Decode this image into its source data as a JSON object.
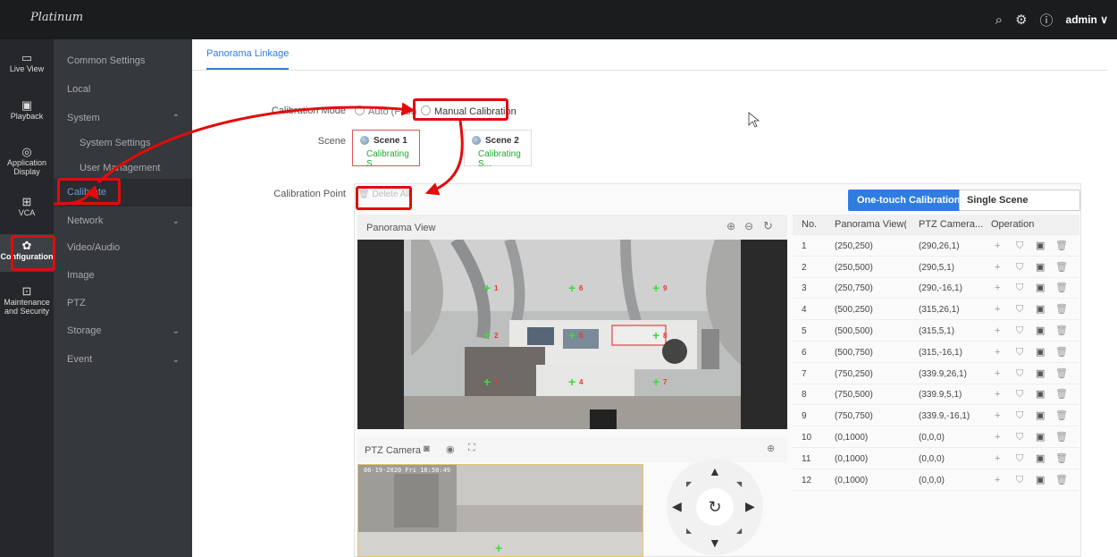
{
  "app": {
    "logo": "Platinum",
    "user": "admin ∨"
  },
  "leftnav": [
    {
      "label": "Live View",
      "icon": "▭"
    },
    {
      "label": "Playback",
      "icon": "▣"
    },
    {
      "label": "Application Display",
      "icon": "◎"
    },
    {
      "label": "VCA",
      "icon": "⊞"
    },
    {
      "label": "Configuration",
      "icon": "✿"
    },
    {
      "label": "Maintenance and Security",
      "icon": "⊡"
    }
  ],
  "subnav": {
    "common": "Common Settings",
    "local": "Local",
    "system": "System",
    "system_settings": "System Settings",
    "user_management": "User Management",
    "calibrate": "Calibrate",
    "network": "Network",
    "video_audio": "Video/Audio",
    "image": "Image",
    "ptz": "PTZ",
    "storage": "Storage",
    "event": "Event"
  },
  "tab": "Panorama Linkage",
  "form": {
    "mode_label": "Calibration Mode",
    "mode_auto": "Auto (Fast)",
    "mode_manual": "Manual Calibration",
    "scene_label": "Scene",
    "cp_label": "Calibration Point",
    "delete_all": "Delete All",
    "one_touch": "One-touch Calibration",
    "single_scene": "Single Scene Calibration"
  },
  "scenes": [
    {
      "title": "Scene 1",
      "status": "Calibrating S..."
    },
    {
      "title": "Scene 2",
      "status": "Calibrating S..."
    }
  ],
  "panorama": {
    "title": "Panorama View",
    "icons": [
      "zoom-in-icon",
      "zoom-out-icon",
      "refresh-icon"
    ]
  },
  "ptz": {
    "title": "PTZ Camera",
    "osd": "06-19-2020 Fri 16:50:49"
  },
  "table": {
    "headers": [
      "No.",
      "Panorama View(...",
      "PTZ Camera...",
      "Operation"
    ],
    "rows": [
      [
        "1",
        "(250,250)",
        "(290,26,1)"
      ],
      [
        "2",
        "(250,500)",
        "(290,5,1)"
      ],
      [
        "3",
        "(250,750)",
        "(290,-16,1)"
      ],
      [
        "4",
        "(500,250)",
        "(315,26,1)"
      ],
      [
        "5",
        "(500,500)",
        "(315,5,1)"
      ],
      [
        "6",
        "(500,750)",
        "(315,-16,1)"
      ],
      [
        "7",
        "(750,250)",
        "(339.9,26,1)"
      ],
      [
        "8",
        "(750,500)",
        "(339.9,5,1)"
      ],
      [
        "9",
        "(750,750)",
        "(339.9,-16,1)"
      ],
      [
        "10",
        "(0,1000)",
        "(0,0,0)"
      ],
      [
        "11",
        "(0,1000)",
        "(0,0,0)"
      ],
      [
        "12",
        "(0,1000)",
        "(0,0,0)"
      ]
    ]
  },
  "markers": [
    "1",
    "2",
    "3",
    "4",
    "5",
    "6",
    "7",
    "8",
    "9"
  ],
  "colors": {
    "accent": "#2f7de1",
    "highlight": "#e30b0b",
    "success": "#22aa33",
    "marker_green": "#3cdc3c"
  }
}
